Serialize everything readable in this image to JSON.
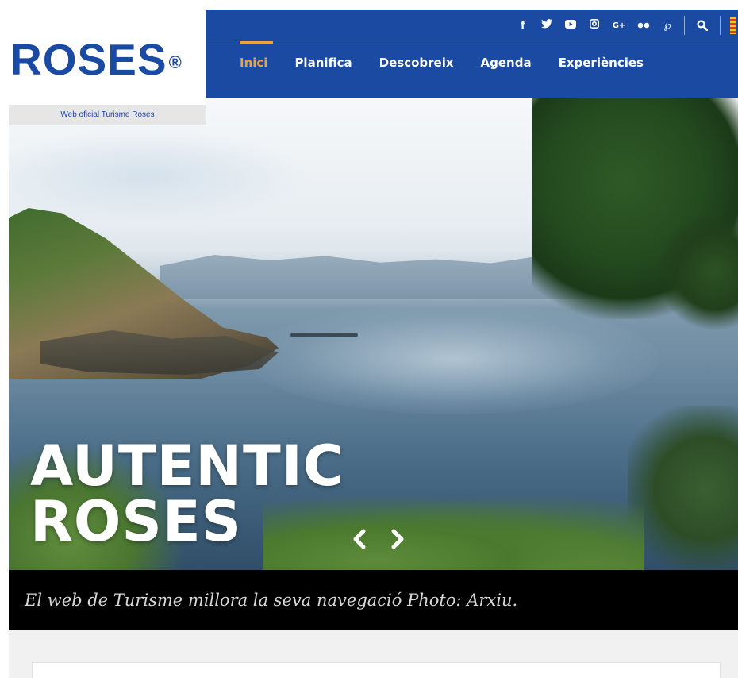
{
  "brand": {
    "logo_text": "ROSES",
    "logo_mark": "®",
    "tagline": "Web oficial Turisme Roses",
    "color_primary": "#1b4aa3",
    "color_accent": "#f0a23a"
  },
  "social_icons": [
    {
      "icon": "facebook-icon",
      "glyph": "f"
    },
    {
      "icon": "twitter-icon",
      "glyph": "🐦"
    },
    {
      "icon": "youtube-icon",
      "glyph": "▶"
    },
    {
      "icon": "instagram-icon",
      "glyph": "◎"
    },
    {
      "icon": "google-plus-icon",
      "glyph": "G+"
    },
    {
      "icon": "flickr-icon",
      "glyph": "●●"
    },
    {
      "icon": "pinterest-icon",
      "glyph": "P"
    }
  ],
  "nav": {
    "items": [
      {
        "label": "Inici",
        "active": true
      },
      {
        "label": "Planifica",
        "active": false
      },
      {
        "label": "Descobreix",
        "active": false
      },
      {
        "label": "Agenda",
        "active": false
      },
      {
        "label": "Experiències",
        "active": false
      }
    ]
  },
  "hero": {
    "title_line1": "AUTENTIC",
    "title_line2": "ROSES",
    "prev_icon": "chevron-left-icon",
    "next_icon": "chevron-right-icon"
  },
  "caption": {
    "text": "El web de Turisme millora la seva navegació Photo: Arxiu."
  }
}
